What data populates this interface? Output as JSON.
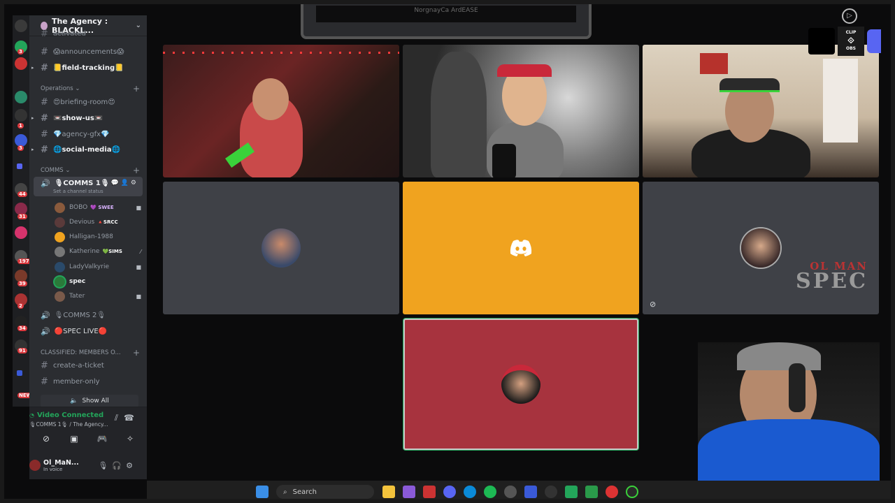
{
  "server": {
    "name": "The Agency : BLACKL..."
  },
  "channels": {
    "partial_top": "activated",
    "announcements": "😱announcements😱",
    "field_tracking": "📒field-tracking📒",
    "briefing_room": "😍briefing-room😍",
    "show_us": "📼show-us📼",
    "agency_gfx": "💎agency-gfx💎",
    "social_media": "🌐social-media🌐",
    "create_ticket": "create-a-ticket",
    "member_only": "member-only"
  },
  "categories": {
    "operations": "Operations",
    "comms": "COMMS",
    "classified": "CLASSIFIED: MEMBERS O..."
  },
  "voice_channels": {
    "comms1": "🎙COMMS 1🎙",
    "comms1_status": "Set a channel status",
    "comms2": "🎙COMMS 2🎙",
    "spec_live": "🔴SPEC LIVE🔴"
  },
  "members": [
    {
      "name": "BOBO",
      "tag": "SWEE",
      "color": "#8a5a3c"
    },
    {
      "name": "Devious",
      "tag": "SRCC",
      "color": "#5a3a3a"
    },
    {
      "name": "Halligan-1988",
      "tag": "",
      "color": "#f0a31f"
    },
    {
      "name": "Katherine",
      "tag": "SIMS",
      "color": "#777"
    },
    {
      "name": "LadyValkyrie",
      "tag": "",
      "color": "#2a4a6a"
    },
    {
      "name": "spec",
      "tag": "",
      "color": "#2a7a3a"
    },
    {
      "name": "Tater",
      "tag": "",
      "color": "#7a5a4a"
    }
  ],
  "show_all": "Show All",
  "voice_panel": {
    "status": "Video Connected",
    "location": "🎙COMMS 1🎙 / The Agency..."
  },
  "user": {
    "name": "Ol_MaN...",
    "status": "In voice"
  },
  "overlay": {
    "spec_top": "OL MAN",
    "spec_bottom": "SPEC",
    "clip": "CLIP",
    "obs": "OBS"
  },
  "taskbar": {
    "search_placeholder": "Search"
  },
  "top_window_text": "NorgnayCa ArdEASE"
}
